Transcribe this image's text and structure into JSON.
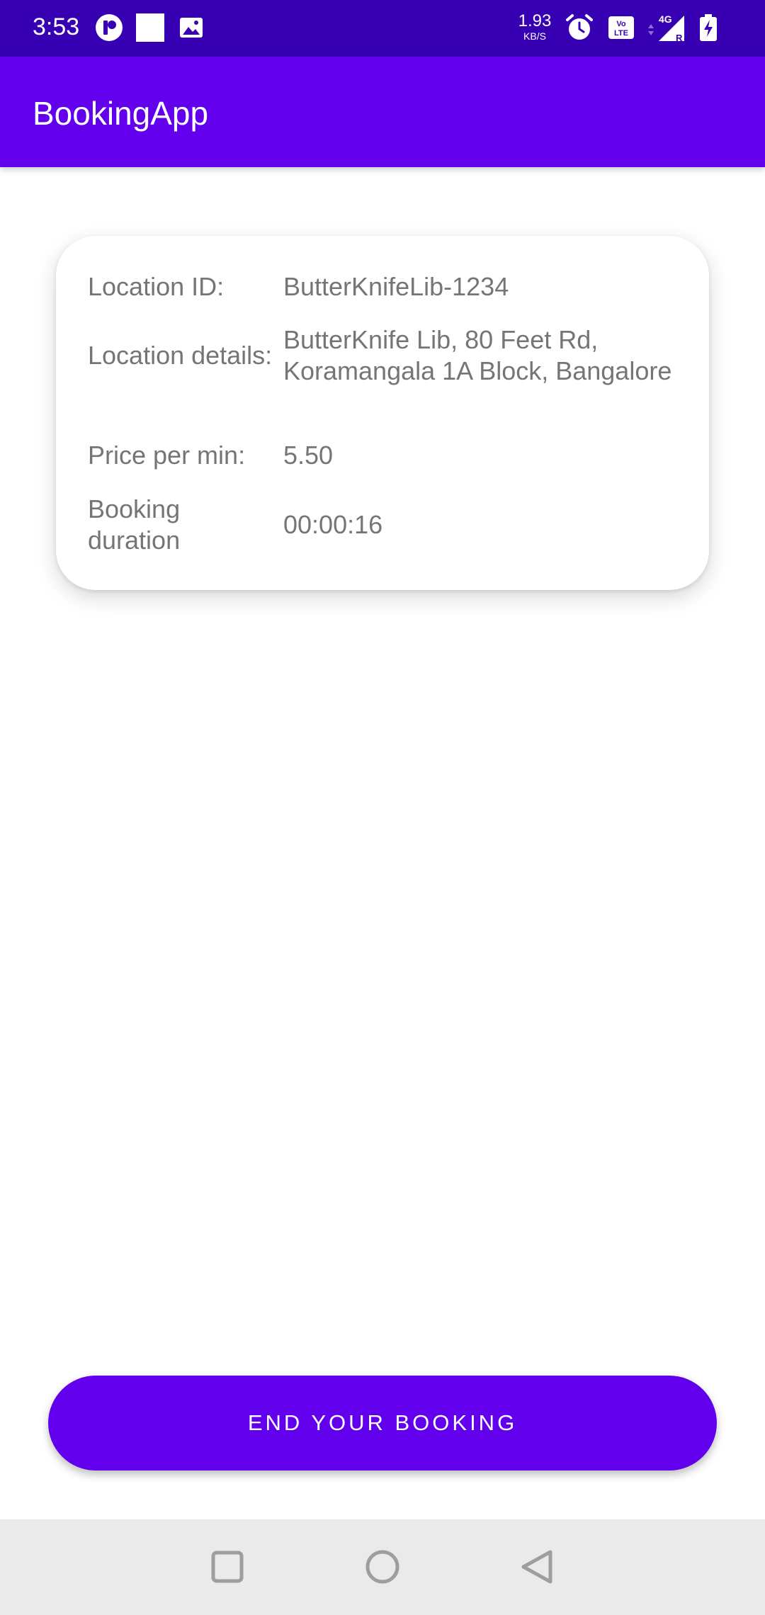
{
  "status_bar": {
    "time": "3:53",
    "net_speed_value": "1.93",
    "net_speed_unit": "KB/S",
    "icons": [
      "app-notification-icon",
      "square-notification-icon",
      "image-notification-icon",
      "alarm-icon",
      "volte-icon",
      "signal-4g-icon",
      "battery-charging-icon"
    ],
    "volte_label": "Vo LTE",
    "network_label": "4G",
    "roaming_label": "R"
  },
  "app_bar": {
    "title": "BookingApp",
    "color": "#6200ee"
  },
  "booking_card": {
    "rows": [
      {
        "label": "Location ID:",
        "value": "ButterKnifeLib-1234"
      },
      {
        "label": "Location details:",
        "value": "ButterKnife Lib, 80 Feet Rd, Koramangala 1A Block, Bangalore"
      },
      {
        "label": "Price per min:",
        "value": "5.50"
      },
      {
        "label": "Booking duration",
        "value": "00:00:16"
      }
    ]
  },
  "actions": {
    "end_booking_label": "END YOUR BOOKING"
  },
  "nav_bar": {
    "buttons": [
      "recents-icon",
      "home-icon",
      "back-icon"
    ]
  }
}
